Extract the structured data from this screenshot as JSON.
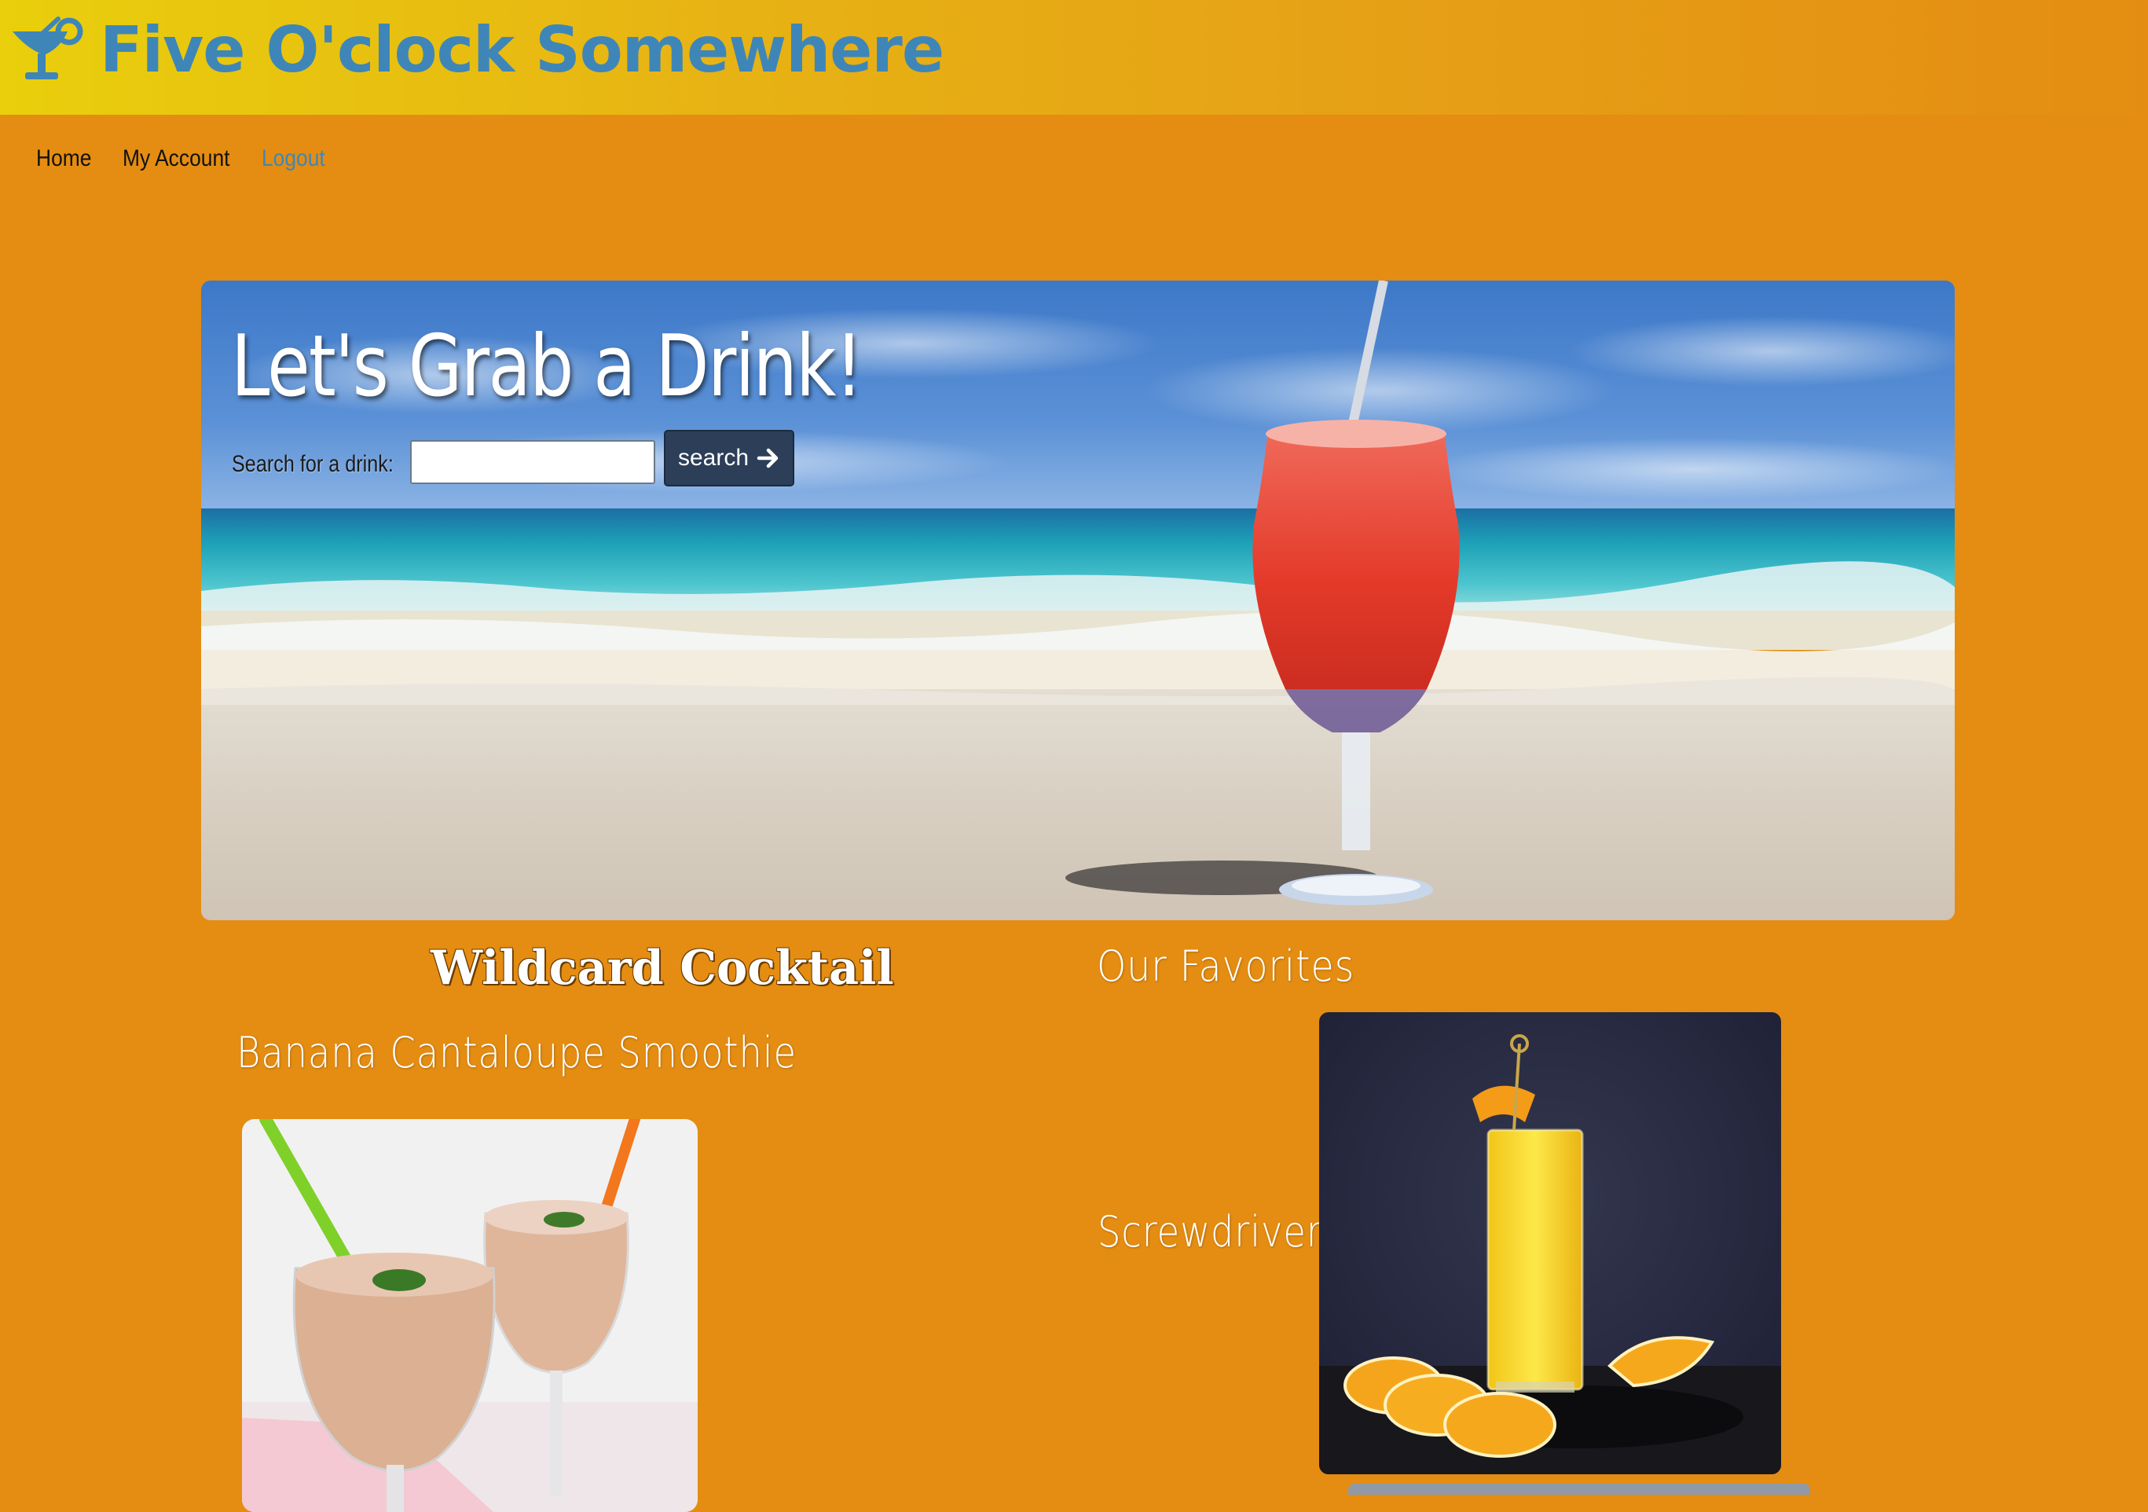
{
  "header": {
    "title": "Five O'clock Somewhere",
    "logo_icon": "cocktail-glass-icon",
    "gradient_colors": [
      "#e9cf0c",
      "#e48d12"
    ],
    "title_color": "#3f86b8"
  },
  "nav": {
    "items": [
      {
        "label": "Home"
      },
      {
        "label": "My Account"
      },
      {
        "label": "Logout"
      }
    ]
  },
  "hero": {
    "title": "Let's Grab a Drink!",
    "search_label": "Search for a drink:",
    "search_value": "",
    "search_button_label": "search",
    "search_button_icon": "arrow-right-icon",
    "background_image": "beach-cocktail-image"
  },
  "wildcard": {
    "heading": "Wildcard Cocktail",
    "drink_name": "Banana Cantaloupe Smoothie",
    "image": "smoothie-glasses-image"
  },
  "favorites": {
    "heading": "Our Favorites",
    "items": [
      {
        "name": "Screwdriver",
        "image": "screwdriver-glass-image"
      }
    ]
  },
  "colors": {
    "page_background": "#e48d12",
    "button_background": "#2c3e58",
    "link_color": "#3f86b8"
  }
}
